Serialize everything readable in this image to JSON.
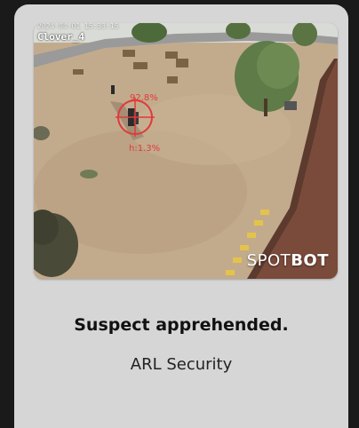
{
  "feed": {
    "camera_label": "Clover_4",
    "timestamp": "2024-04-01 15:33:15",
    "detection": {
      "confidence": "92.8%",
      "height": "h:1.3%"
    },
    "watermark": {
      "light": "SPOT",
      "bold": "BOT"
    },
    "colors": {
      "detection": "#e03a3a",
      "ground": "#bda688",
      "wall": "#7a4a3a"
    }
  },
  "caption": {
    "title": "Suspect apprehended.",
    "subtitle": "ARL Security"
  }
}
